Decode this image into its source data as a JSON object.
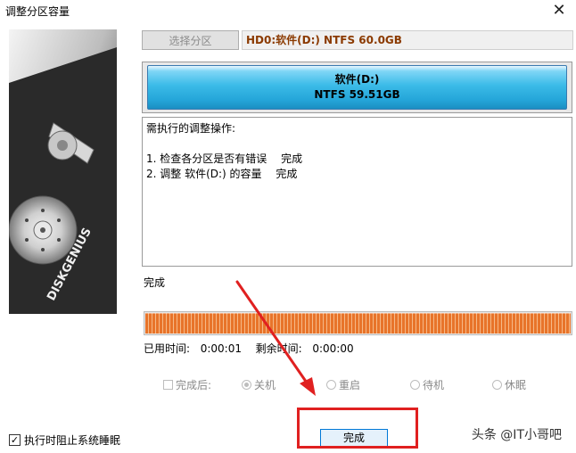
{
  "window": {
    "title": "调整分区容量",
    "close_glyph": "✕"
  },
  "side_image": {
    "brand_text": "DISKGENIUS"
  },
  "toolbar": {
    "select_partition_label": "选择分区"
  },
  "disk_info": "HD0:软件(D:) NTFS 60.0GB",
  "partition": {
    "name": "软件(D:)",
    "detail": "NTFS 59.51GB"
  },
  "operations": {
    "header": "需执行的调整操作:",
    "items": [
      "1. 检查各分区是否有错误　 完成",
      "2. 调整 软件(D:) 的容量　 完成"
    ]
  },
  "status_text": "完成",
  "progress": {
    "value_percent": 100,
    "color": "#e8742a"
  },
  "time": {
    "elapsed_label": "已用时间:",
    "elapsed_value": "0:00:01",
    "remaining_label": "剩余时间:",
    "remaining_value": "0:00:00"
  },
  "after_completion": {
    "label": "完成后:",
    "options": [
      "关机",
      "重启",
      "待机",
      "休眠"
    ],
    "selected": "关机"
  },
  "prevent_sleep": {
    "label": "执行时阻止系统睡眠",
    "checked": true
  },
  "finish_button": {
    "label": "完成"
  },
  "annotation": {
    "color": "#e02020"
  },
  "watermark": "头条 @IT小哥吧"
}
